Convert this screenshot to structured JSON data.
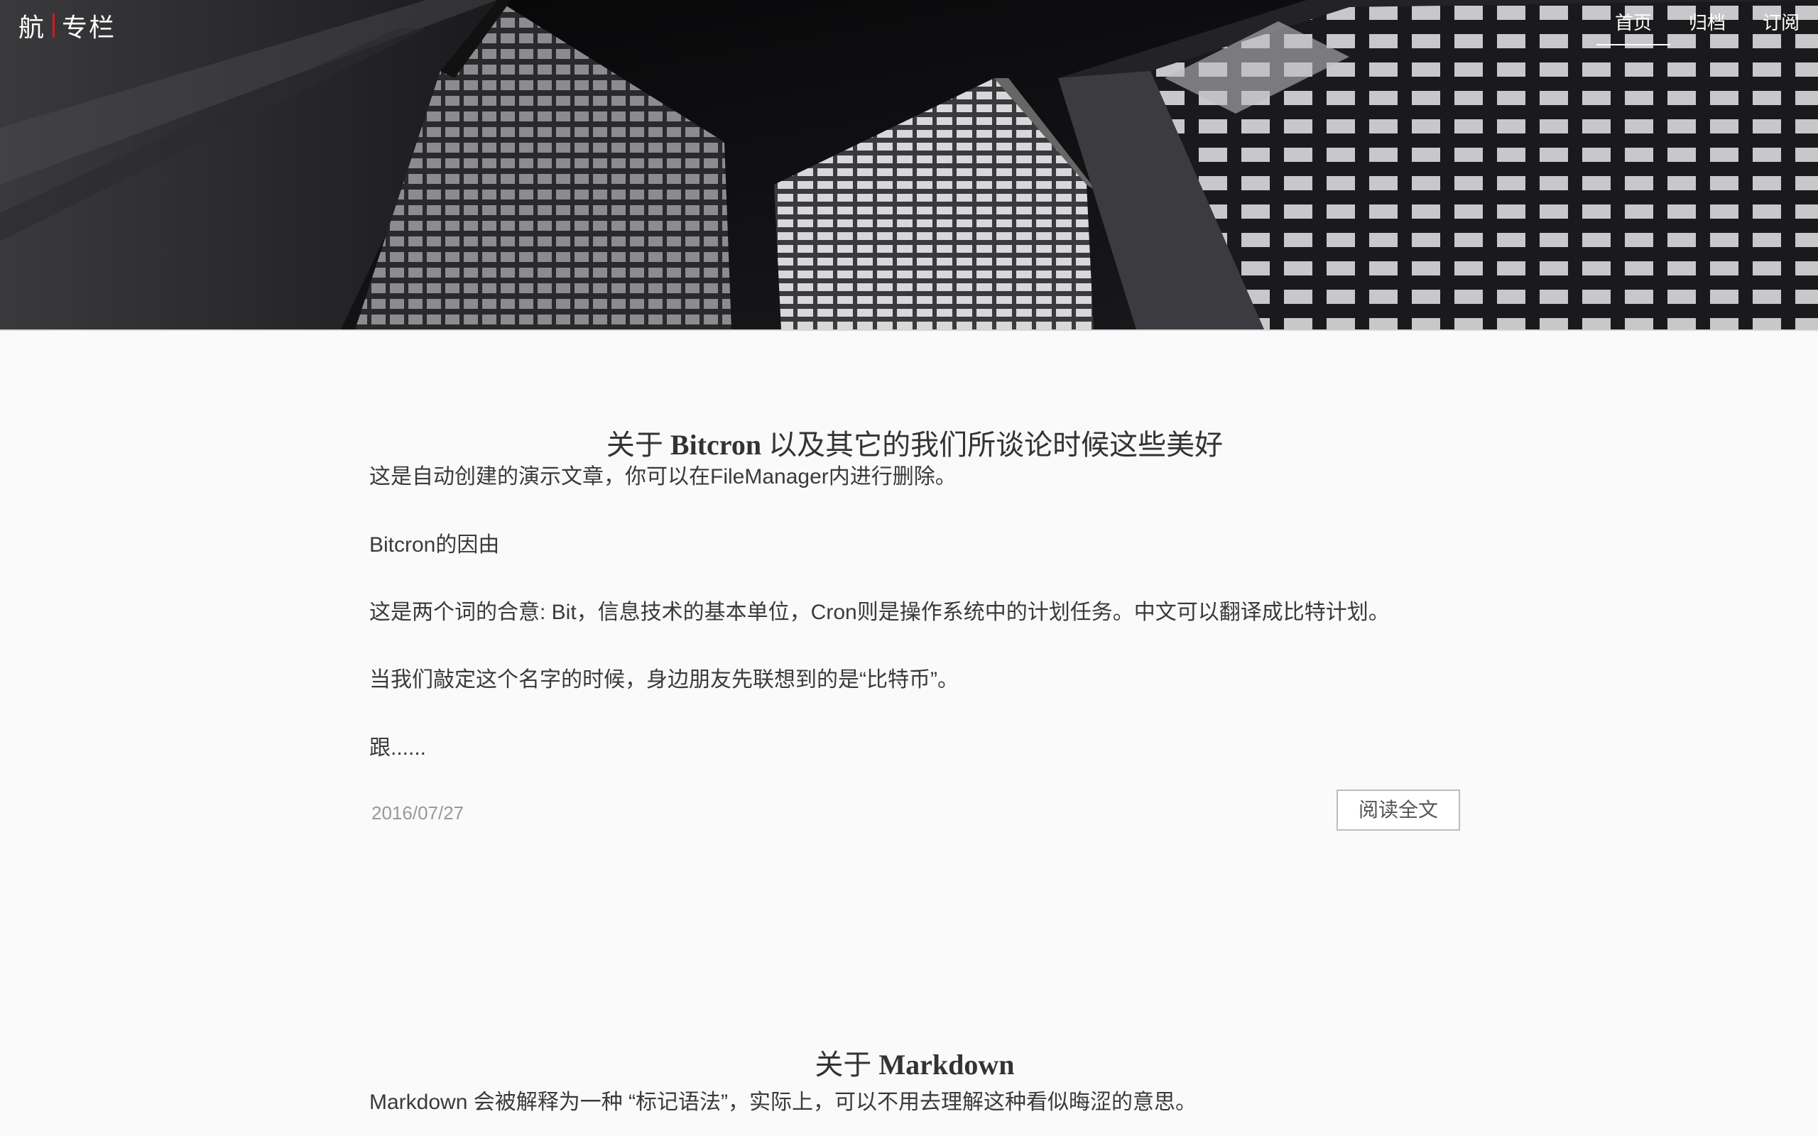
{
  "header": {
    "logo_left": "航",
    "logo_right": "专栏",
    "nav": [
      {
        "label": "首页",
        "active": true
      },
      {
        "label": "归档",
        "active": false
      },
      {
        "label": "订阅",
        "active": false
      }
    ],
    "accent_color": "#d31b1b"
  },
  "posts": [
    {
      "title_pre": "关于 ",
      "title_en": "Bitcron",
      "title_post": " 以及其它的我们所谈论时候这些美好",
      "paragraphs": [
        "这是自动创建的演示文章，你可以在FileManager内进行删除。",
        "Bitcron的因由",
        "这是两个词的合意: Bit，信息技术的基本单位，Cron则是操作系统中的计划任务。中文可以翻译成比特计划。",
        "当我们敲定这个名字的时候，身边朋友先联想到的是“比特币”。",
        "跟......"
      ],
      "date": "2016/07/27",
      "read_more": "阅读全文"
    },
    {
      "title_pre": "关于 ",
      "title_en": "Markdown",
      "title_post": "",
      "paragraphs": [
        "Markdown 会被解释为一种 “标记语法”，实际上，可以不用去理解这种看似晦涩的意思。"
      ]
    }
  ]
}
